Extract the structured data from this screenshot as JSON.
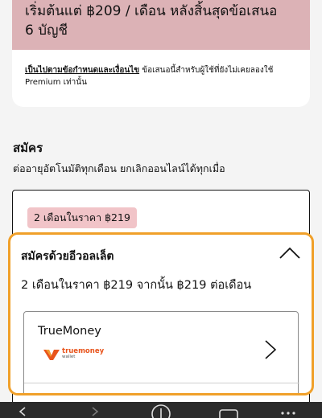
{
  "offer": {
    "headline_line1": "เริ่มต้นแต่ ฿209 / เดือน หลังสิ้นสุดข้อเสนอ",
    "headline_line2": "6 บัญชี",
    "terms_link": "เป็นไปตามข้อกำหนดและเงื่อนไข",
    "terms_text": " ข้อเสนอนี้สำหรับผู้ใช้ที่ยังไม่เคยลองใช้ Premium เท่านั้น"
  },
  "subscribe": {
    "title": "สมัคร",
    "subtitle": "ต่ออายุอัตโนมัติทุกเดือน ยกเลิกออนไลน์ได้ทุกเมื่อ",
    "plan_badge": "2 เดือนในราคา ฿219"
  },
  "wallet": {
    "title": "สมัครด้วยอีวอลเล็ต",
    "price_text": "2 เดือนในราคา ฿219 จากนั้น ฿219 ต่อเดือน",
    "option_name": "TrueMoney",
    "logo_brand": "truemoney",
    "logo_sub": "wallet"
  },
  "colors": {
    "highlight": "#f0a02a",
    "banner": "#dcb2b6",
    "badge": "#f1c4c8",
    "brand_orange": "#e8541c"
  },
  "icons": [
    "chevron-up-icon",
    "chevron-right-icon",
    "truemoney-logo",
    "back-icon",
    "forward-icon",
    "add-tab-icon",
    "tabs-icon",
    "menu-icon"
  ]
}
